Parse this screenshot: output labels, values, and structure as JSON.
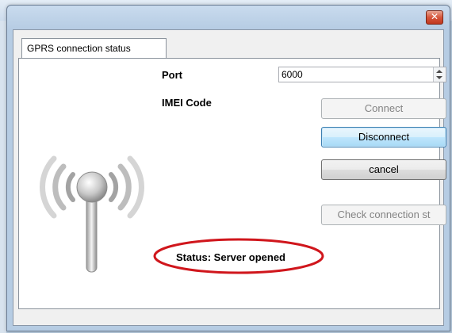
{
  "window": {
    "close_icon": "close-x-icon"
  },
  "tab": {
    "label": "GPRS connection status"
  },
  "form": {
    "port_label": "Port",
    "port_value": "6000",
    "imei_label": "IMEI Code"
  },
  "buttons": {
    "connect": "Connect",
    "disconnect": "Disconnect",
    "cancel": "cancel",
    "check": "Check connection st"
  },
  "status": {
    "text": "Status: Server opened"
  },
  "colors": {
    "highlight_ellipse": "#d0161c",
    "close_button": "#c9452c"
  }
}
